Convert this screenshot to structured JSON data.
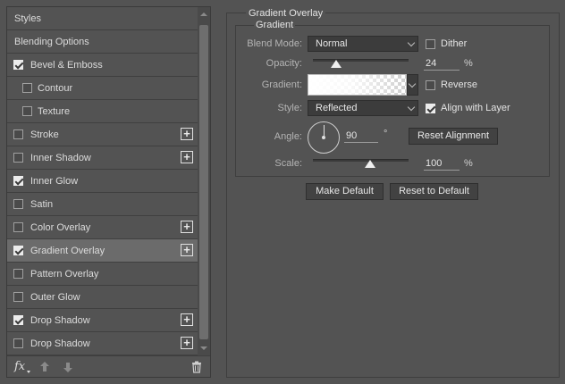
{
  "styles_panel": {
    "items": [
      {
        "label": "Styles",
        "type": "header",
        "selected": false
      },
      {
        "label": "Blending Options",
        "type": "header",
        "selected": false
      },
      {
        "label": "Bevel & Emboss",
        "checked": true,
        "plus": false
      },
      {
        "label": "Contour",
        "checked": false,
        "indent": true
      },
      {
        "label": "Texture",
        "checked": false,
        "indent": true
      },
      {
        "label": "Stroke",
        "checked": false,
        "plus": true
      },
      {
        "label": "Inner Shadow",
        "checked": false,
        "plus": true
      },
      {
        "label": "Inner Glow",
        "checked": true,
        "plus": false
      },
      {
        "label": "Satin",
        "checked": false,
        "plus": false
      },
      {
        "label": "Color Overlay",
        "checked": false,
        "plus": true
      },
      {
        "label": "Gradient Overlay",
        "checked": true,
        "plus": true,
        "selected": true
      },
      {
        "label": "Pattern Overlay",
        "checked": false,
        "plus": false
      },
      {
        "label": "Outer Glow",
        "checked": false,
        "plus": false
      },
      {
        "label": "Drop Shadow",
        "checked": true,
        "plus": true
      },
      {
        "label": "Drop Shadow",
        "checked": false,
        "plus": true
      }
    ],
    "bottom_icons": {
      "fx": "fx",
      "move_up": "arrow-up-icon",
      "move_down": "arrow-down-icon",
      "delete": "trash-icon"
    }
  },
  "gradient_overlay": {
    "title": "Gradient Overlay",
    "group_title": "Gradient",
    "blend_mode": {
      "label": "Blend Mode:",
      "value": "Normal"
    },
    "dither": {
      "label": "Dither",
      "checked": false
    },
    "opacity": {
      "label": "Opacity:",
      "value": "24",
      "unit": "%",
      "fraction": 0.24
    },
    "gradient": {
      "label": "Gradient:",
      "reverse_label": "Reverse",
      "reverse_checked": false
    },
    "style": {
      "label": "Style:",
      "value": "Reflected"
    },
    "align_with_layer": {
      "label": "Align with Layer",
      "checked": true
    },
    "angle": {
      "label": "Angle:",
      "value": "90",
      "unit": "°"
    },
    "reset_alignment_label": "Reset Alignment",
    "scale": {
      "label": "Scale:",
      "value": "100",
      "unit": "%",
      "fraction": 0.6
    }
  },
  "buttons": {
    "make_default": "Make Default",
    "reset_to_default": "Reset to Default"
  },
  "colors": {
    "background": "#535353",
    "selected_row": "#6b6b6b"
  }
}
